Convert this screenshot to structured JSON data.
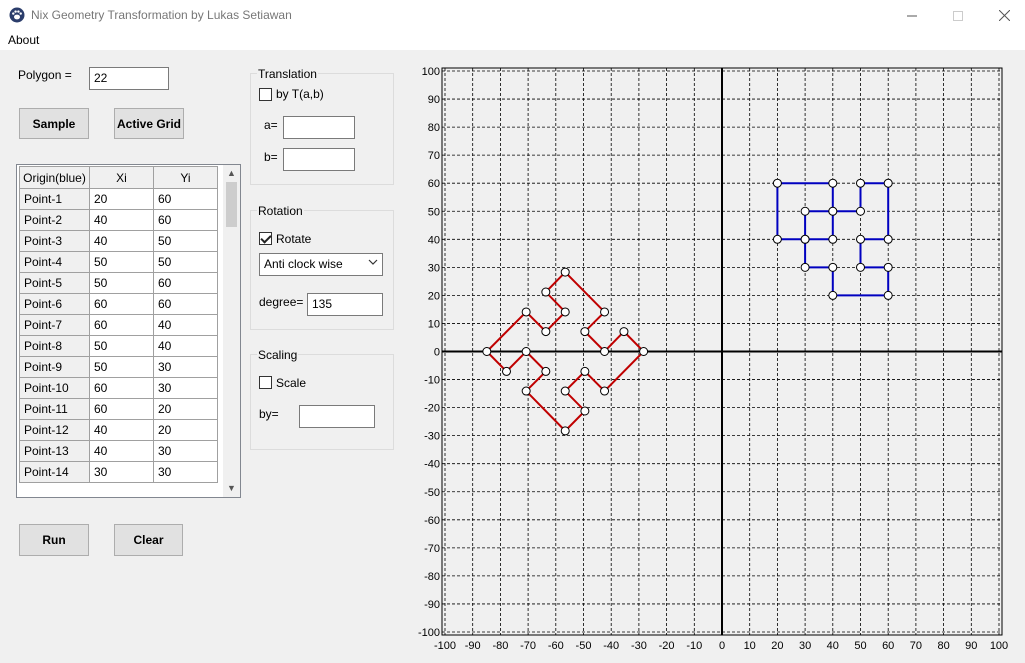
{
  "window": {
    "title": "Nix Geometry Transformation by Lukas Setiawan"
  },
  "menu": {
    "about": "About"
  },
  "polygon": {
    "label": "Polygon =",
    "value": "22"
  },
  "buttons": {
    "sample": "Sample",
    "active_grid": "Active Grid",
    "run": "Run",
    "clear": "Clear"
  },
  "table": {
    "headers": [
      "Origin(blue)",
      "Xi",
      "Yi"
    ],
    "rows": [
      [
        "Point-1",
        "20",
        "60"
      ],
      [
        "Point-2",
        "40",
        "60"
      ],
      [
        "Point-3",
        "40",
        "50"
      ],
      [
        "Point-4",
        "50",
        "50"
      ],
      [
        "Point-5",
        "50",
        "60"
      ],
      [
        "Point-6",
        "60",
        "60"
      ],
      [
        "Point-7",
        "60",
        "40"
      ],
      [
        "Point-8",
        "50",
        "40"
      ],
      [
        "Point-9",
        "50",
        "30"
      ],
      [
        "Point-10",
        "60",
        "30"
      ],
      [
        "Point-11",
        "60",
        "20"
      ],
      [
        "Point-12",
        "40",
        "20"
      ],
      [
        "Point-13",
        "40",
        "30"
      ],
      [
        "Point-14",
        "30",
        "30"
      ]
    ]
  },
  "translation": {
    "title": "Translation",
    "checkbox_label": "by T(a,b)",
    "checked": false,
    "a_label": "a=",
    "a_value": "",
    "b_label": "b=",
    "b_value": ""
  },
  "rotation": {
    "title": "Rotation",
    "checkbox_label": "Rotate",
    "checked": true,
    "direction": "Anti clock wise",
    "degree_label": "degree=",
    "degree_value": "135"
  },
  "scaling": {
    "title": "Scaling",
    "checkbox_label": "Scale",
    "checked": false,
    "by_label": "by=",
    "by_value": ""
  },
  "plot": {
    "xlim": [
      -100,
      100
    ],
    "ylim": [
      -100,
      100
    ],
    "tick_step": 10,
    "x_ticks": [
      "-100",
      "-90",
      "-80",
      "-70",
      "-60",
      "-50",
      "-40",
      "-30",
      "-20",
      "-10",
      "0",
      "10",
      "20",
      "30",
      "40",
      "50",
      "60",
      "70",
      "80",
      "90",
      "100"
    ],
    "y_ticks": [
      "100",
      "90",
      "80",
      "70",
      "60",
      "50",
      "40",
      "30",
      "20",
      "10",
      "0",
      "-10",
      "-20",
      "-30",
      "-40",
      "-50",
      "-60",
      "-70",
      "-80",
      "-90",
      "-100"
    ],
    "original_color": "#0000c0",
    "transformed_color": "#c00000",
    "original": [
      [
        20,
        60
      ],
      [
        40,
        60
      ],
      [
        40,
        50
      ],
      [
        50,
        50
      ],
      [
        50,
        60
      ],
      [
        60,
        60
      ],
      [
        60,
        40
      ],
      [
        50,
        40
      ],
      [
        50,
        30
      ],
      [
        60,
        30
      ],
      [
        60,
        20
      ],
      [
        40,
        20
      ],
      [
        40,
        30
      ],
      [
        30,
        30
      ],
      [
        30,
        40
      ],
      [
        40,
        40
      ],
      [
        40,
        50
      ],
      [
        30,
        50
      ],
      [
        30,
        40
      ],
      [
        20,
        40
      ],
      [
        20,
        60
      ]
    ],
    "transformed": [
      [
        -56.6,
        -28.3
      ],
      [
        -70.7,
        -14.1
      ],
      [
        -63.6,
        -7.1
      ],
      [
        -70.7,
        0
      ],
      [
        -77.8,
        -7.1
      ],
      [
        -84.9,
        0
      ],
      [
        -70.7,
        14.1
      ],
      [
        -63.6,
        7.1
      ],
      [
        -56.6,
        14.1
      ],
      [
        -63.6,
        21.2
      ],
      [
        -56.6,
        28.3
      ],
      [
        -42.4,
        14.1
      ],
      [
        -49.5,
        7.1
      ],
      [
        -42.4,
        0
      ],
      [
        -35.4,
        7.1
      ],
      [
        -28.3,
        0
      ],
      [
        -42.4,
        -14.1
      ],
      [
        -49.5,
        -7.1
      ],
      [
        -56.6,
        -14.1
      ],
      [
        -49.5,
        -21.2
      ],
      [
        -56.6,
        -28.3
      ]
    ]
  }
}
